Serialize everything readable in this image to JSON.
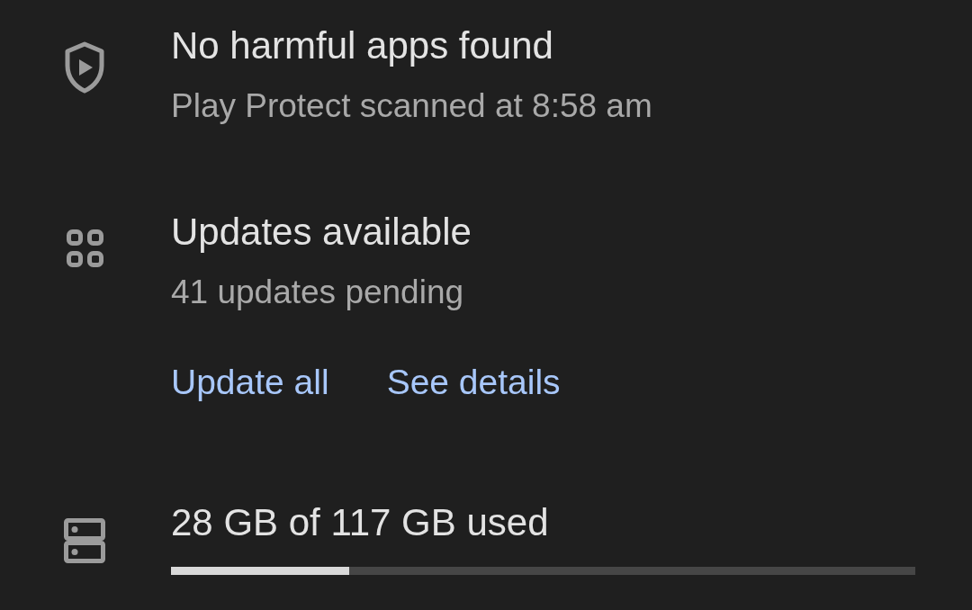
{
  "items": [
    {
      "kind": "security",
      "title": "No harmful apps found",
      "subtitle": "Play Protect scanned at 8:58 am"
    },
    {
      "kind": "updates",
      "title": "Updates available",
      "subtitle": "41 updates pending",
      "actions": [
        "Update all",
        "See details"
      ]
    },
    {
      "kind": "storage",
      "title": "28 GB of 117 GB used",
      "level": 0.24
    }
  ]
}
